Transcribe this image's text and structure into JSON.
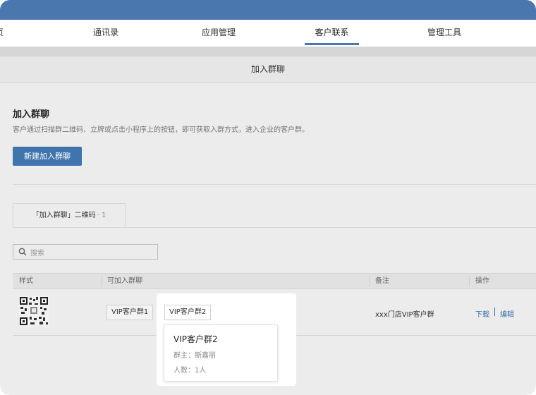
{
  "nav": {
    "items": [
      {
        "label": "页"
      },
      {
        "label": "通讯录"
      },
      {
        "label": "应用管理"
      },
      {
        "label": "客户联系"
      },
      {
        "label": "管理工具"
      }
    ],
    "active_index": 3
  },
  "page": {
    "header_title": "加入群聊",
    "section_title": "加入群聊",
    "section_desc": "客户通过扫描群二维码、立牌或点击小程序上的按钮，即可获取入群方式，进入企业的客户群。",
    "new_button": "新建加入群聊"
  },
  "tabs": [
    {
      "label": "「加入群聊」二维码",
      "count": "· 1"
    }
  ],
  "search": {
    "placeholder": "搜索"
  },
  "table": {
    "headers": [
      "样式",
      "可加入群聊",
      "备注",
      "操作"
    ],
    "rows": [
      {
        "groups": [
          "VIP客户群1",
          "VIP客户群2"
        ],
        "note": "xxx门店VIP客户群",
        "actions": [
          "下载",
          "编辑"
        ]
      }
    ]
  },
  "popover": {
    "title": "VIP客户群2",
    "owner": "群主：斯嘉丽",
    "members": "人数：1人"
  },
  "colors": {
    "accent": "#4a77ad",
    "button": "#3f74ad",
    "link": "#3a6ca8"
  },
  "icons": [
    "search-icon",
    "qr-code-icon"
  ]
}
